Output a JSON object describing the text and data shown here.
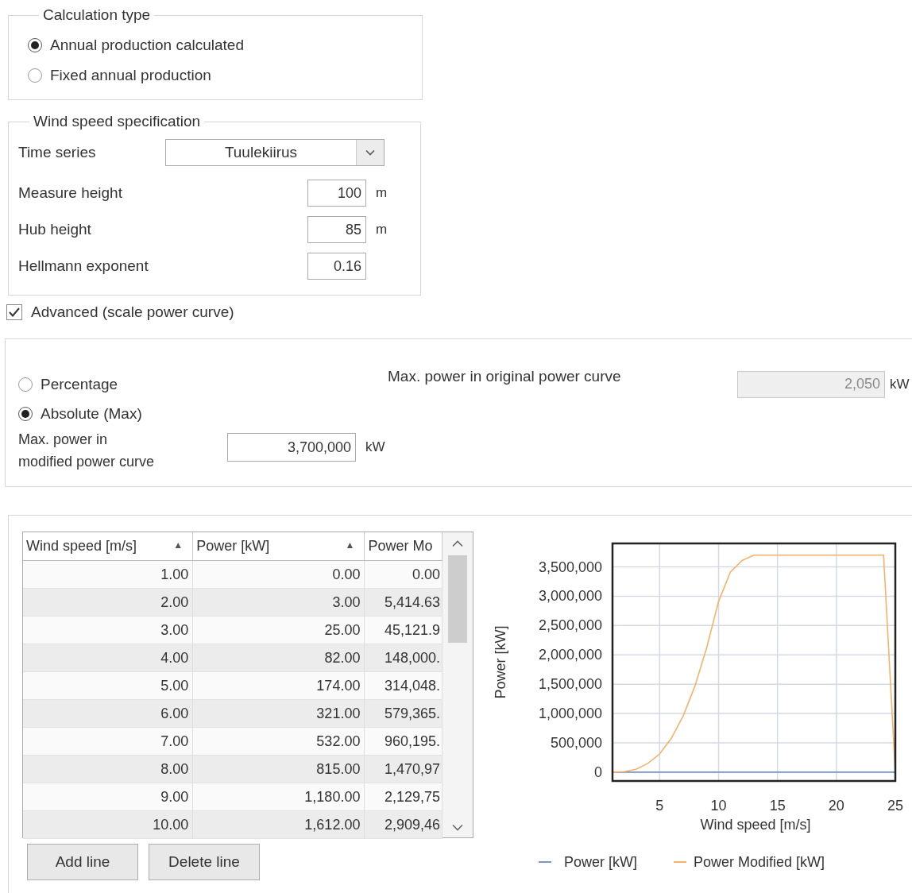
{
  "calculation_type": {
    "legend": "Calculation type",
    "options": [
      {
        "label": "Annual production calculated",
        "selected": true
      },
      {
        "label": "Fixed annual production",
        "selected": false
      }
    ]
  },
  "wind_speed_specification": {
    "legend": "Wind speed specification",
    "time_series": {
      "label": "Time series",
      "value": "Tuulekiirus"
    },
    "fields": [
      {
        "label": "Measure height",
        "value": "100",
        "unit": "m"
      },
      {
        "label": "Hub height",
        "value": "85",
        "unit": "m"
      },
      {
        "label": "Hellmann exponent",
        "value": "0.16"
      }
    ]
  },
  "advanced": {
    "label": "Advanced (scale power curve)",
    "checked": true
  },
  "scaling": {
    "options": [
      {
        "label": "Percentage",
        "selected": false
      },
      {
        "label": "Absolute (Max)",
        "selected": true
      }
    ],
    "modified_max": {
      "label_lines": [
        "Max. power in",
        "modified power curve"
      ],
      "value": "3,700,000",
      "unit": "kW"
    },
    "original_max": {
      "label": "Max. power in original power curve",
      "value": "2,050",
      "unit": "kW",
      "disabled": true
    }
  },
  "table": {
    "columns": [
      {
        "label": "Wind speed [m/s]",
        "sort": "▲"
      },
      {
        "label": "Power [kW]",
        "sort": "▲"
      },
      {
        "label": "Power Mo"
      }
    ],
    "rows": [
      [
        "1.00",
        "0.00",
        "0.00"
      ],
      [
        "2.00",
        "3.00",
        "5,414.63"
      ],
      [
        "3.00",
        "25.00",
        "45,121.9"
      ],
      [
        "4.00",
        "82.00",
        "148,000."
      ],
      [
        "5.00",
        "174.00",
        "314,048."
      ],
      [
        "6.00",
        "321.00",
        "579,365."
      ],
      [
        "7.00",
        "532.00",
        "960,195."
      ],
      [
        "8.00",
        "815.00",
        "1,470,97"
      ],
      [
        "9.00",
        "1,180.00",
        "2,129,75"
      ],
      [
        "10.00",
        "1,612.00",
        "2,909,46"
      ]
    ]
  },
  "buttons": [
    "Add line",
    "Delete line"
  ],
  "chart": {
    "chart_data": {
      "type": "line",
      "xlabel": "Wind speed [m/s]",
      "ylabel": "Power [kW]",
      "x": [
        1,
        2,
        3,
        4,
        5,
        6,
        7,
        8,
        9,
        10,
        11,
        12,
        13,
        14,
        15,
        16,
        17,
        18,
        19,
        20,
        21,
        22,
        23,
        24,
        25
      ],
      "series": [
        {
          "name": "Power [kW]",
          "color": "#7b96c8",
          "values": [
            0,
            0,
            0,
            0,
            0,
            0,
            0,
            0,
            0,
            0,
            0,
            0,
            0,
            0,
            0,
            0,
            0,
            0,
            0,
            0,
            0,
            0,
            0,
            0,
            0
          ]
        },
        {
          "name": "Power Modified [kW]",
          "color": "#f5b26b",
          "values": [
            0,
            10000,
            50000,
            150000,
            310000,
            580000,
            960000,
            1470000,
            2130000,
            2910000,
            3410000,
            3610000,
            3700000,
            3700000,
            3700000,
            3700000,
            3700000,
            3700000,
            3700000,
            3700000,
            3700000,
            3700000,
            3700000,
            3700000,
            0
          ]
        }
      ],
      "grid": true,
      "legend": true,
      "xlim": [
        1,
        25
      ],
      "ylim": [
        -150000,
        3900000
      ],
      "xticks": [
        5,
        10,
        15,
        20,
        25
      ],
      "yticks": [
        {
          "value": 0,
          "label": "0"
        },
        {
          "value": 500000,
          "label": "500,000"
        },
        {
          "value": 1000000,
          "label": "1,000,000"
        },
        {
          "value": 1500000,
          "label": "1,500,000"
        },
        {
          "value": 2000000,
          "label": "2,000,000"
        },
        {
          "value": 2500000,
          "label": "2,500,000"
        },
        {
          "value": 3000000,
          "label": "3,000,000"
        },
        {
          "value": 3500000,
          "label": "3,500,000"
        }
      ]
    }
  }
}
